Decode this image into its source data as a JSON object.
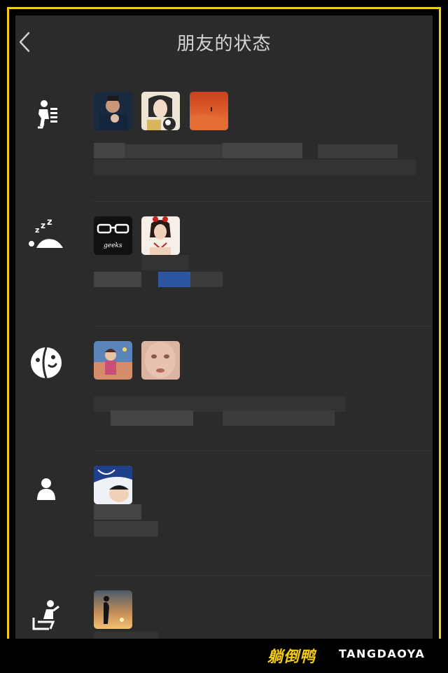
{
  "header": {
    "title": "朋友的状态",
    "back_icon": "chevron-left-icon"
  },
  "sections": [
    {
      "icon": "running-person-icon",
      "avatar_count": 3
    },
    {
      "icon": "sleeping-zzz-icon",
      "avatar_count": 2
    },
    {
      "icon": "smiling-face-icon",
      "avatar_count": 2
    },
    {
      "icon": "person-icon",
      "avatar_count": 1
    },
    {
      "icon": "person-sitting-icon",
      "avatar_count": 1
    }
  ],
  "watermark": {
    "brand_cn": "躺倒鸭",
    "brand_en": "TANGDAOYA"
  },
  "colors": {
    "frame": "#f2cc17",
    "background": "#2b2b2b",
    "title": "#d4d4d4"
  }
}
